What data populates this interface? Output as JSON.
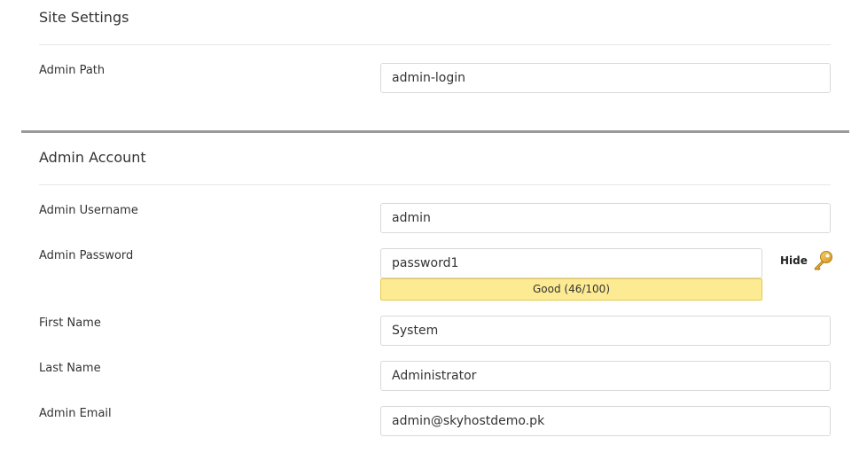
{
  "site_settings": {
    "title": "Site Settings",
    "admin_path": {
      "label": "Admin Path",
      "value": "admin-login"
    }
  },
  "admin_account": {
    "title": "Admin Account",
    "username": {
      "label": "Admin Username",
      "value": "admin"
    },
    "password": {
      "label": "Admin Password",
      "value": "password1",
      "strength_text": "Good (46/100)",
      "strength_color": "#fdeb93",
      "toggle_label": "Hide",
      "toggle_icon": "key-icon"
    },
    "first_name": {
      "label": "First Name",
      "value": "System"
    },
    "last_name": {
      "label": "Last Name",
      "value": "Administrator"
    },
    "email": {
      "label": "Admin Email",
      "value": "admin@skyhostdemo.pk"
    }
  }
}
